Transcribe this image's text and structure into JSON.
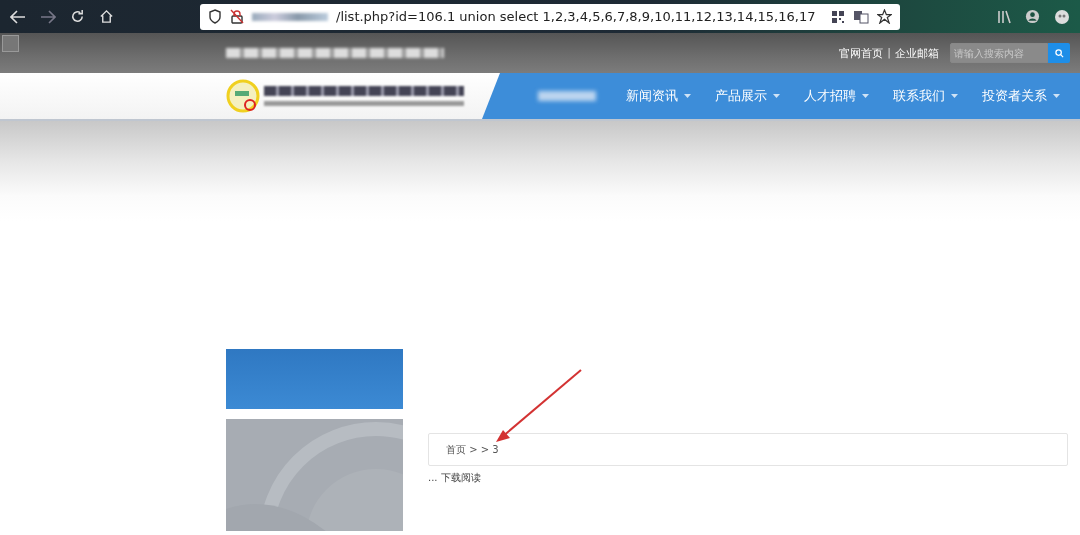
{
  "browser": {
    "url": "/list.php?id=106.1 union select 1,2,3,4,5,6,7,8,9,10,11,12,13,14,15,16,17"
  },
  "top_links": [
    {
      "kind": "link",
      "text": "官网首页"
    },
    {
      "kind": "sep",
      "text": "|"
    },
    {
      "kind": "link",
      "text": "企业邮箱"
    }
  ],
  "search": {
    "placeholder": "请输入搜索内容"
  },
  "nav": [
    {
      "kind": "blurred"
    },
    {
      "kind": "menu",
      "label": "新闻资讯"
    },
    {
      "kind": "menu",
      "label": "产品展示"
    },
    {
      "kind": "menu",
      "label": "人才招聘"
    },
    {
      "kind": "menu",
      "label": "联系我们"
    },
    {
      "kind": "menu",
      "label": "投资者关系"
    }
  ],
  "breadcrumb": "首页 > > 3",
  "content_text": "... 下载阅读",
  "annotation": {
    "kind": "arrow",
    "color": "#d33232"
  }
}
